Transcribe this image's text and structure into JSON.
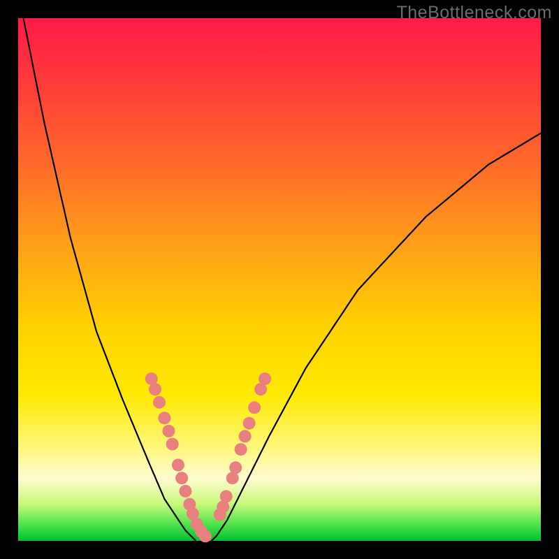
{
  "watermark": "TheBottleneck.com",
  "chart_data": {
    "type": "line",
    "title": "",
    "xlabel": "",
    "ylabel": "",
    "xlim": [
      0,
      100
    ],
    "ylim": [
      0,
      100
    ],
    "series": [
      {
        "name": "left-curve",
        "x": [
          1,
          5,
          10,
          15,
          20,
          25,
          28,
          30,
          32,
          33,
          34
        ],
        "y": [
          100,
          80,
          58,
          40,
          27,
          15,
          8,
          5,
          2,
          1,
          0
        ]
      },
      {
        "name": "right-curve",
        "x": [
          37,
          38,
          40,
          43,
          48,
          55,
          65,
          78,
          90,
          100
        ],
        "y": [
          0,
          1,
          4,
          10,
          20,
          33,
          48,
          62,
          72,
          78
        ]
      }
    ],
    "markers": {
      "name": "data-points-overlay",
      "color": "#e98080",
      "left": {
        "x": [
          25.5,
          26.2,
          27.0,
          28.0,
          28.8,
          29.5,
          30.6,
          31.3,
          32.0,
          32.8,
          33.4,
          34.2,
          35.0,
          35.8
        ],
        "y": [
          31,
          29,
          26.5,
          23.5,
          21,
          18.5,
          14.5,
          12,
          9.5,
          7,
          5.2,
          3.2,
          1.8,
          0.9
        ]
      },
      "right": {
        "x": [
          38.6,
          39.2,
          39.8,
          41.0,
          41.6,
          42.6,
          43.4,
          44.2,
          45.2,
          46.4,
          47.2
        ],
        "y": [
          5,
          6.5,
          8.5,
          12,
          14,
          17.5,
          20,
          22.5,
          25.5,
          29,
          31
        ]
      }
    },
    "colors": {
      "curve": "#000000",
      "marker_fill": "#e98080",
      "background_top": "#ff1a4a",
      "background_bottom": "#00c030",
      "frame": "#000000"
    }
  }
}
